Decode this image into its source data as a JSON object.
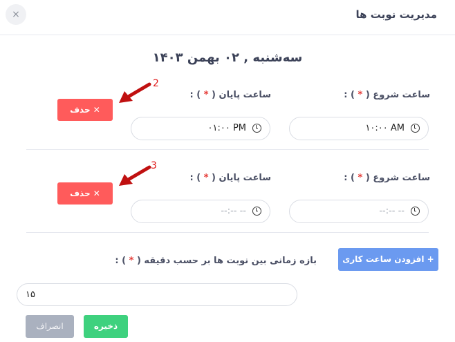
{
  "header": {
    "title": "مدیریت نوبت ها",
    "close_label": "×"
  },
  "date_label": "سه‌شنبه , ۰۲ بهمن ۱۴۰۳",
  "labels": {
    "start_time": "ساعت شروع",
    "end_time": "ساعت پایان",
    "required_open": "(",
    "required_star": "*",
    "required_close": ") :"
  },
  "slots": [
    {
      "start_value": "۱۰:۰۰ AM",
      "end_value": "۰۱:۰۰ PM",
      "delete_label": "✕ حذف",
      "annotation": "2"
    },
    {
      "start_value": "--:-- --",
      "end_value": "--:-- --",
      "delete_label": "✕ حذف",
      "annotation": "3"
    }
  ],
  "add_button": "+  افزودن ساعت کاری",
  "interval": {
    "label": "بازه زمانی بین نوبت ها بر حسب دقیقه",
    "value": "۱۵"
  },
  "footer": {
    "save": "ذخیره",
    "cancel": "انصراف"
  },
  "colors": {
    "delete": "#ff5b5b",
    "add": "#6b9af0",
    "save": "#3ed17e",
    "cancel": "#aab1bf",
    "annotation": "#e01818"
  }
}
